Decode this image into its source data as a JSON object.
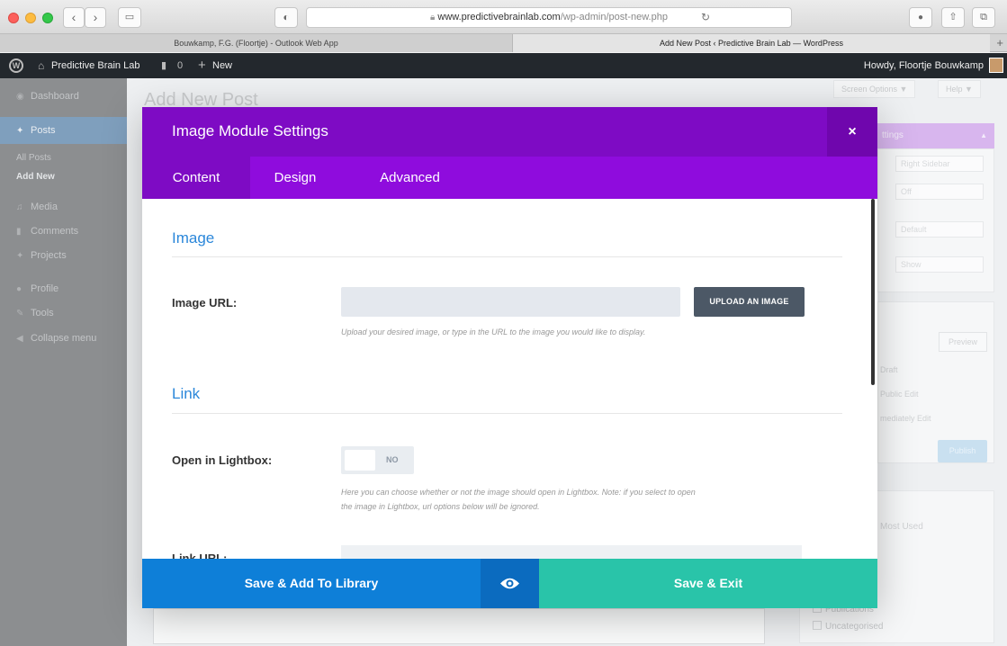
{
  "browser": {
    "url_host": "www.predictivebrainlab.com",
    "url_path": "/wp-admin/post-new.php",
    "tabs": [
      {
        "label": "Bouwkamp, F.G. (Floortje) - Outlook Web App"
      },
      {
        "label": "Add New Post ‹ Predictive Brain Lab — WordPress"
      }
    ]
  },
  "admin_bar": {
    "site_name": "Predictive Brain Lab",
    "comments_count": "0",
    "new_label": "New",
    "howdy": "Howdy, Floortje Bouwkamp"
  },
  "sidebar": {
    "items": [
      {
        "label": "Dashboard",
        "icon": "dashboard-icon"
      },
      {
        "label": "Posts",
        "icon": "pin-icon"
      },
      {
        "label": "Media",
        "icon": "media-icon"
      },
      {
        "label": "Comments",
        "icon": "comment-icon"
      },
      {
        "label": "Projects",
        "icon": "pin-icon"
      },
      {
        "label": "Profile",
        "icon": "user-icon"
      },
      {
        "label": "Tools",
        "icon": "wrench-icon"
      },
      {
        "label": "Collapse menu",
        "icon": "collapse-icon"
      }
    ],
    "sub_items": [
      {
        "label": "All Posts"
      },
      {
        "label": "Add New"
      }
    ]
  },
  "page": {
    "title": "Add New Post",
    "screen_options": "Screen Options ▼",
    "help": "Help ▼",
    "right_panel": {
      "header": "ttings",
      "select1": "Right Sidebar",
      "select2": "Off",
      "select3": "Default",
      "select4": "Show",
      "preview": "Preview",
      "publish": "Publish",
      "text1": "Draft",
      "text2": "Public Edit",
      "text3": "mediately Edit",
      "most_used": "Most Used",
      "cat1": "Publications",
      "cat2": "Uncategorised"
    }
  },
  "modal": {
    "title": "Image Module Settings",
    "close": "×",
    "tabs": [
      {
        "label": "Content"
      },
      {
        "label": "Design"
      },
      {
        "label": "Advanced"
      }
    ],
    "image_section": "Image",
    "image_url_label": "Image URL:",
    "upload_button": "UPLOAD AN IMAGE",
    "image_help": "Upload your desired image, or type in the URL to the image you would like to display.",
    "link_section": "Link",
    "lightbox_label": "Open in Lightbox:",
    "lightbox_value": "NO",
    "lightbox_help_1": "Here you can choose whether or not the image should open in Lightbox. Note: if you select to open",
    "lightbox_help_2": "the image in Lightbox, url options below will be ignored.",
    "link_url_label": "Link URL:",
    "footer": {
      "save_library": "Save & Add To Library",
      "save_exit": "Save & Exit"
    }
  },
  "colors": {
    "modal_header": "#7e0bc4",
    "modal_tabs": "#8f0cdd",
    "section_title": "#2b87da",
    "save_library": "#0e7fd8",
    "save_exit": "#29c4a9"
  }
}
